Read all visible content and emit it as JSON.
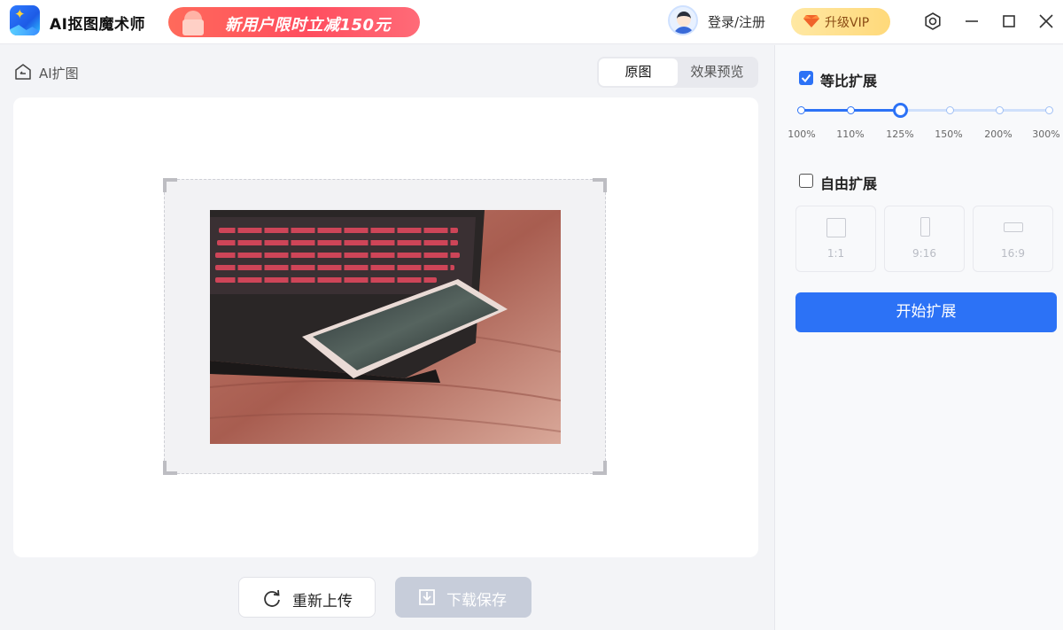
{
  "app": {
    "title": "AI抠图魔术师",
    "promo_text": "新用户限时立减150元",
    "login_label": "登录/注册",
    "vip_label": "升级VIP"
  },
  "window_controls": [
    "settings-icon",
    "minimize-icon",
    "maximize-icon",
    "close-icon"
  ],
  "breadcrumb": {
    "label": "AI扩图"
  },
  "view_toggle": {
    "options": [
      "原图",
      "效果预览"
    ],
    "selected": "原图"
  },
  "actions": {
    "reupload_label": "重新上传",
    "download_label": "下载保存",
    "download_enabled": false
  },
  "side_panel": {
    "proportional": {
      "label": "等比扩展",
      "checked": true,
      "scale_labels": [
        "100%",
        "110%",
        "125%",
        "150%",
        "200%",
        "300%"
      ],
      "selected": "125%"
    },
    "free": {
      "label": "自由扩展",
      "checked": false,
      "ratios": [
        "1:1",
        "9:16",
        "16:9"
      ]
    },
    "start_label": "开始扩展"
  },
  "colors": {
    "accent": "#2c72f6",
    "promo": "#ff4d5e",
    "vip": "#ffd97a",
    "disabled_button": "#c7cdda"
  }
}
